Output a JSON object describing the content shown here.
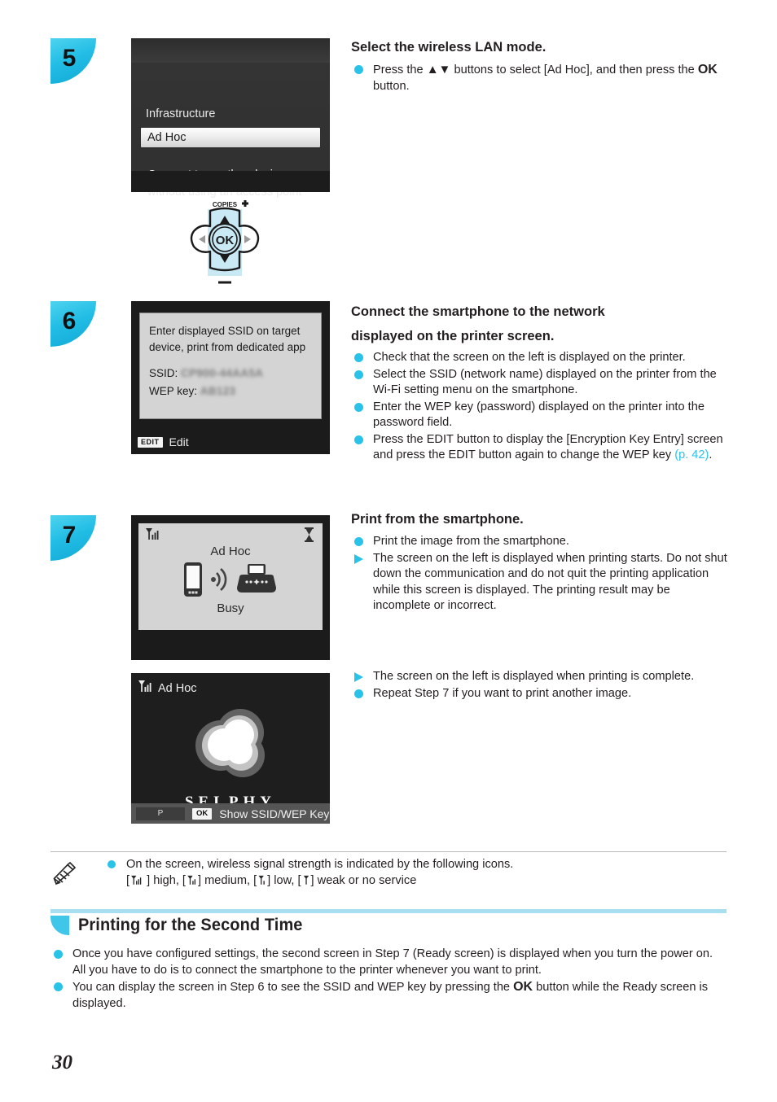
{
  "page": {
    "number": "30"
  },
  "steps": [
    {
      "badge": "5",
      "heading": "Select the wireless LAN mode.",
      "bullets": [
        {
          "marker": "dot",
          "parts": [
            {
              "t": "text",
              "v": "Press the "
            },
            {
              "t": "glyph",
              "v": "▲▼"
            },
            {
              "t": "text",
              "v": " buttons to select [Ad Hoc], and then press the "
            },
            {
              "t": "bold",
              "v": "OK"
            },
            {
              "t": "text",
              "v": " button."
            }
          ]
        }
      ],
      "screen": {
        "type": "menu",
        "unselected_item": "Infrastructure",
        "selected_item": "Ad Hoc",
        "description_line1": "Connect to another device",
        "description_line2": "without using an access point"
      },
      "control": {
        "label": "COPIES",
        "ok_label": "OK"
      }
    },
    {
      "badge": "6",
      "heading_line1": "Connect the smartphone to the network",
      "heading_line2": "displayed on the printer screen.",
      "bullets": [
        {
          "marker": "dot",
          "parts": [
            {
              "t": "text",
              "v": "Check that the screen on the left is displayed on the printer."
            }
          ]
        },
        {
          "marker": "dot",
          "parts": [
            {
              "t": "text",
              "v": "Select the SSID (network name) displayed on the printer from the Wi-Fi setting menu on the smartphone."
            }
          ]
        },
        {
          "marker": "dot",
          "parts": [
            {
              "t": "text",
              "v": "Enter the WEP key (password) displayed on the printer into the password field."
            }
          ]
        },
        {
          "marker": "dot",
          "parts": [
            {
              "t": "text",
              "v": "Press the EDIT button to display the [Encryption Key Entry] screen and press the EDIT button again to change the WEP key "
            },
            {
              "t": "pageref",
              "v": "(p. 42)"
            },
            {
              "t": "text",
              "v": "."
            }
          ]
        }
      ],
      "screen": {
        "type": "ssid",
        "message_line1": "Enter displayed SSID on target",
        "message_line2": "device, print from dedicated app",
        "ssid_label": "SSID:",
        "ssid_value": "CP900-44AA5A",
        "wep_label": "WEP key:",
        "wep_value": "AB123",
        "softkey_badge": "EDIT",
        "softkey_label": "Edit"
      }
    },
    {
      "badge": "7",
      "heading": "Print from the smartphone.",
      "bullets": [
        {
          "marker": "dot",
          "parts": [
            {
              "t": "text",
              "v": "Print the image from the smartphone."
            }
          ]
        },
        {
          "marker": "tri",
          "parts": [
            {
              "t": "text",
              "v": "The screen on the left is displayed when printing starts. Do not shut down the communication and do not quit the printing application while this screen is displayed. The printing result may be incomplete or incorrect."
            }
          ]
        }
      ],
      "bullets2": [
        {
          "marker": "tri",
          "parts": [
            {
              "t": "text",
              "v": "The screen on the left is displayed when printing is complete."
            }
          ]
        },
        {
          "marker": "dot",
          "parts": [
            {
              "t": "text",
              "v": "Repeat Step 7 if you want to print another image."
            }
          ]
        }
      ],
      "screen_busy": {
        "type": "busy",
        "signal_icon": "signal-strength-high-icon",
        "status_icon": "hourglass-icon",
        "title": "Ad Hoc",
        "status": "Busy",
        "left_icon": "smartphone-icon",
        "middle_icon": "wireless-wave-icon",
        "right_icon": "printer-icon"
      },
      "screen_ready": {
        "type": "ready",
        "signal_icon": "signal-strength-high-icon",
        "mode": "Ad Hoc",
        "logo_icon": "selphy-cloud-logo-icon",
        "logo_text": "SELPHY",
        "softkey_p": "P",
        "softkey_ok": "OK",
        "softkey_label": "Show SSID/WEP Key"
      }
    }
  ],
  "note": {
    "icon": "pencil-icon",
    "line1": "On the screen, wireless signal strength is indicated by the following icons.",
    "levels": [
      {
        "bracket_open": "[",
        "icon": "signal-high-icon",
        "bracket_close": "]",
        "label": "high,"
      },
      {
        "bracket_open": "[",
        "icon": "signal-medium-icon",
        "bracket_close": "]",
        "label": "medium,"
      },
      {
        "bracket_open": "[",
        "icon": "signal-low-icon",
        "bracket_close": "]",
        "label": "low,"
      },
      {
        "bracket_open": "[",
        "icon": "signal-none-icon",
        "bracket_close": "]",
        "label": "weak or no service"
      }
    ]
  },
  "section": {
    "title": "Printing for the Second Time",
    "bullets": [
      {
        "marker": "dot",
        "parts": [
          {
            "t": "text",
            "v": "Once you have configured settings, the second screen in Step 7 (Ready screen) is displayed when you turn the power on. All you have to do is to connect the smartphone to the printer whenever you want to print."
          }
        ]
      },
      {
        "marker": "dot",
        "parts": [
          {
            "t": "text",
            "v": "You can display the screen in Step 6 to see the SSID and WEP key by pressing the "
          },
          {
            "t": "bold",
            "v": "OK"
          },
          {
            "t": "text",
            "v": " button while the Ready screen is displayed."
          }
        ]
      }
    ]
  },
  "colors": {
    "accent": "#29c3ea",
    "section_rule": "#a8dff0",
    "page_ref": "#29c3ea"
  }
}
